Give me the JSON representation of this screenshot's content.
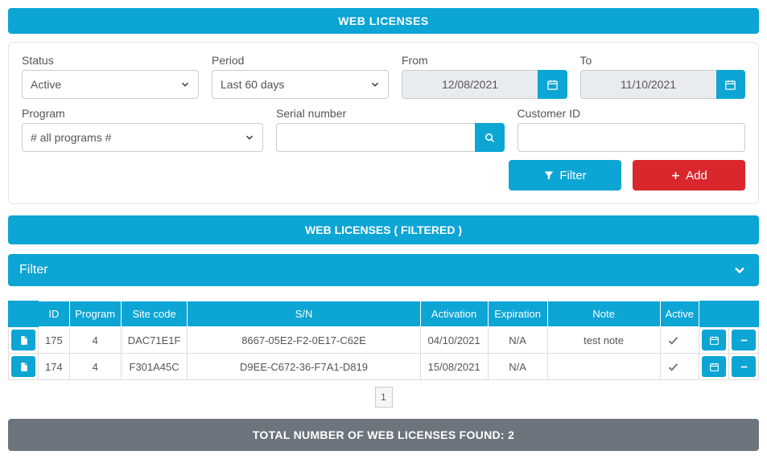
{
  "header": {
    "title": "WEB LICENSES"
  },
  "filters": {
    "status": {
      "label": "Status",
      "value": "Active"
    },
    "period": {
      "label": "Period",
      "value": "Last 60 days"
    },
    "from": {
      "label": "From",
      "value": "12/08/2021"
    },
    "to": {
      "label": "To",
      "value": "11/10/2021"
    },
    "program": {
      "label": "Program",
      "value": "# all programs #"
    },
    "serial": {
      "label": "Serial number",
      "value": ""
    },
    "customer": {
      "label": "Customer ID",
      "value": ""
    },
    "buttons": {
      "filter": "Filter",
      "add": "Add"
    }
  },
  "sections": {
    "filtered_title": "WEB LICENSES ( FILTERED )",
    "filter_toggle": "Filter"
  },
  "table": {
    "columns": [
      "",
      "ID",
      "Program",
      "Site code",
      "S/N",
      "Activation",
      "Expiration",
      "Note",
      "Active",
      "",
      ""
    ],
    "rows": [
      {
        "id": "175",
        "program": "4",
        "site_code": "DAC71E1F",
        "sn": "8667-05E2-F2-0E17-C62E",
        "activation": "04/10/2021",
        "expiration": "N/A",
        "note": "test note",
        "active": true
      },
      {
        "id": "174",
        "program": "4",
        "site_code": "F301A45C",
        "sn": "D9EE-C672-36-F7A1-D819",
        "activation": "15/08/2021",
        "expiration": "N/A",
        "note": "",
        "active": true
      }
    ],
    "page": "1"
  },
  "footer": {
    "total": "TOTAL NUMBER OF WEB LICENSES FOUND: 2"
  }
}
